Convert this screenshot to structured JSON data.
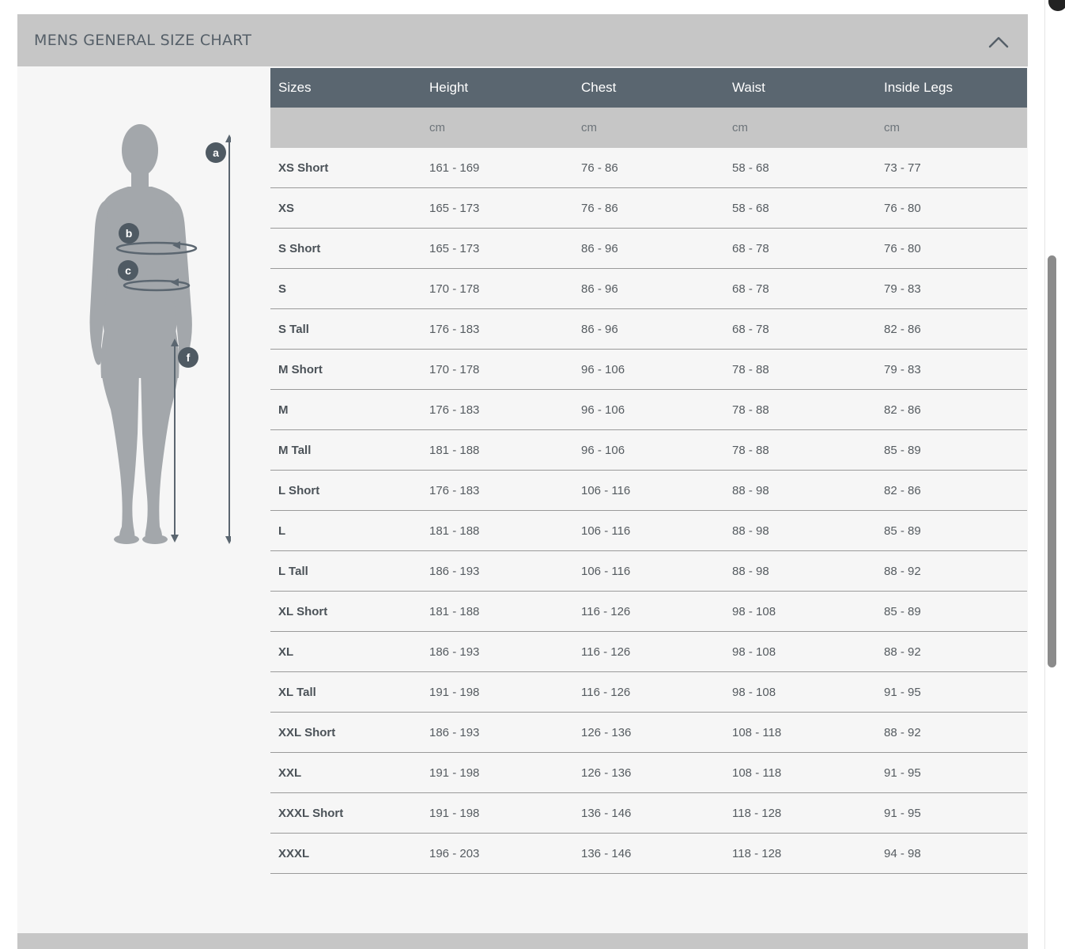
{
  "panel": {
    "title": "MENS GENERAL SIZE CHART",
    "collapse_icon": "chevron-up-icon"
  },
  "figure": {
    "labels": [
      "a",
      "b",
      "c",
      "f"
    ]
  },
  "table": {
    "headers": [
      "Sizes",
      "Height",
      "Chest",
      "Waist",
      "Inside Legs"
    ],
    "units": [
      "",
      "cm",
      "cm",
      "cm",
      "cm"
    ],
    "rows": [
      [
        "XS Short",
        "161 - 169",
        "76 - 86",
        "58 - 68",
        "73 - 77"
      ],
      [
        "XS",
        "165 - 173",
        "76 - 86",
        "58 - 68",
        "76 - 80"
      ],
      [
        "S Short",
        "165 - 173",
        "86 - 96",
        "68 - 78",
        "76 - 80"
      ],
      [
        "S",
        "170 - 178",
        "86 - 96",
        "68 - 78",
        "79 - 83"
      ],
      [
        "S Tall",
        "176 - 183",
        "86 - 96",
        "68 - 78",
        "82 - 86"
      ],
      [
        "M Short",
        "170 - 178",
        "96 - 106",
        "78 - 88",
        "79 - 83"
      ],
      [
        "M",
        "176 - 183",
        "96 - 106",
        "78 - 88",
        "82 - 86"
      ],
      [
        "M Tall",
        "181 - 188",
        "96 - 106",
        "78 - 88",
        "85 - 89"
      ],
      [
        "L Short",
        "176 - 183",
        "106 - 116",
        "88 - 98",
        "82 - 86"
      ],
      [
        "L",
        "181 - 188",
        "106 - 116",
        "88 - 98",
        "85 - 89"
      ],
      [
        "L Tall",
        "186 - 193",
        "106 - 116",
        "88 - 98",
        "88 - 92"
      ],
      [
        "XL Short",
        "181 - 188",
        "116 - 126",
        "98 - 108",
        "85 - 89"
      ],
      [
        "XL",
        "186 - 193",
        "116 - 126",
        "98 - 108",
        "88 - 92"
      ],
      [
        "XL Tall",
        "191 - 198",
        "116 - 126",
        "98 - 108",
        "91 - 95"
      ],
      [
        "XXL Short",
        "186 - 193",
        "126 - 136",
        "108 - 118",
        "88 - 92"
      ],
      [
        "XXL",
        "191 - 198",
        "126 - 136",
        "108 - 118",
        "91 - 95"
      ],
      [
        "XXXL Short",
        "191 - 198",
        "136 - 146",
        "118 - 128",
        "91 - 95"
      ],
      [
        "XXXL",
        "196 - 203",
        "136 - 146",
        "118 - 128",
        "94 - 98"
      ]
    ]
  },
  "colors": {
    "header_bar": "#c6c6c6",
    "table_head": "#5a6670",
    "panel_bg": "#f6f6f6",
    "figure": "#a3a7ab",
    "measure": "#5b6670"
  }
}
